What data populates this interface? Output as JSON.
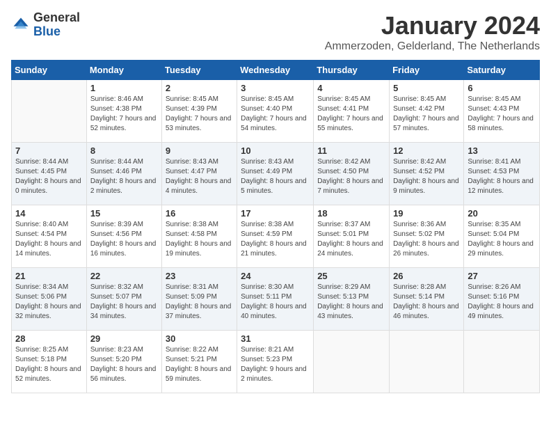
{
  "logo": {
    "general": "General",
    "blue": "Blue"
  },
  "title": "January 2024",
  "subtitle": "Ammerzoden, Gelderland, The Netherlands",
  "days_of_week": [
    "Sunday",
    "Monday",
    "Tuesday",
    "Wednesday",
    "Thursday",
    "Friday",
    "Saturday"
  ],
  "weeks": [
    [
      {
        "day": "",
        "sunrise": "",
        "sunset": "",
        "daylight": ""
      },
      {
        "day": "1",
        "sunrise": "Sunrise: 8:46 AM",
        "sunset": "Sunset: 4:38 PM",
        "daylight": "Daylight: 7 hours and 52 minutes."
      },
      {
        "day": "2",
        "sunrise": "Sunrise: 8:45 AM",
        "sunset": "Sunset: 4:39 PM",
        "daylight": "Daylight: 7 hours and 53 minutes."
      },
      {
        "day": "3",
        "sunrise": "Sunrise: 8:45 AM",
        "sunset": "Sunset: 4:40 PM",
        "daylight": "Daylight: 7 hours and 54 minutes."
      },
      {
        "day": "4",
        "sunrise": "Sunrise: 8:45 AM",
        "sunset": "Sunset: 4:41 PM",
        "daylight": "Daylight: 7 hours and 55 minutes."
      },
      {
        "day": "5",
        "sunrise": "Sunrise: 8:45 AM",
        "sunset": "Sunset: 4:42 PM",
        "daylight": "Daylight: 7 hours and 57 minutes."
      },
      {
        "day": "6",
        "sunrise": "Sunrise: 8:45 AM",
        "sunset": "Sunset: 4:43 PM",
        "daylight": "Daylight: 7 hours and 58 minutes."
      }
    ],
    [
      {
        "day": "7",
        "sunrise": "Sunrise: 8:44 AM",
        "sunset": "Sunset: 4:45 PM",
        "daylight": "Daylight: 8 hours and 0 minutes."
      },
      {
        "day": "8",
        "sunrise": "Sunrise: 8:44 AM",
        "sunset": "Sunset: 4:46 PM",
        "daylight": "Daylight: 8 hours and 2 minutes."
      },
      {
        "day": "9",
        "sunrise": "Sunrise: 8:43 AM",
        "sunset": "Sunset: 4:47 PM",
        "daylight": "Daylight: 8 hours and 4 minutes."
      },
      {
        "day": "10",
        "sunrise": "Sunrise: 8:43 AM",
        "sunset": "Sunset: 4:49 PM",
        "daylight": "Daylight: 8 hours and 5 minutes."
      },
      {
        "day": "11",
        "sunrise": "Sunrise: 8:42 AM",
        "sunset": "Sunset: 4:50 PM",
        "daylight": "Daylight: 8 hours and 7 minutes."
      },
      {
        "day": "12",
        "sunrise": "Sunrise: 8:42 AM",
        "sunset": "Sunset: 4:52 PM",
        "daylight": "Daylight: 8 hours and 9 minutes."
      },
      {
        "day": "13",
        "sunrise": "Sunrise: 8:41 AM",
        "sunset": "Sunset: 4:53 PM",
        "daylight": "Daylight: 8 hours and 12 minutes."
      }
    ],
    [
      {
        "day": "14",
        "sunrise": "Sunrise: 8:40 AM",
        "sunset": "Sunset: 4:54 PM",
        "daylight": "Daylight: 8 hours and 14 minutes."
      },
      {
        "day": "15",
        "sunrise": "Sunrise: 8:39 AM",
        "sunset": "Sunset: 4:56 PM",
        "daylight": "Daylight: 8 hours and 16 minutes."
      },
      {
        "day": "16",
        "sunrise": "Sunrise: 8:38 AM",
        "sunset": "Sunset: 4:58 PM",
        "daylight": "Daylight: 8 hours and 19 minutes."
      },
      {
        "day": "17",
        "sunrise": "Sunrise: 8:38 AM",
        "sunset": "Sunset: 4:59 PM",
        "daylight": "Daylight: 8 hours and 21 minutes."
      },
      {
        "day": "18",
        "sunrise": "Sunrise: 8:37 AM",
        "sunset": "Sunset: 5:01 PM",
        "daylight": "Daylight: 8 hours and 24 minutes."
      },
      {
        "day": "19",
        "sunrise": "Sunrise: 8:36 AM",
        "sunset": "Sunset: 5:02 PM",
        "daylight": "Daylight: 8 hours and 26 minutes."
      },
      {
        "day": "20",
        "sunrise": "Sunrise: 8:35 AM",
        "sunset": "Sunset: 5:04 PM",
        "daylight": "Daylight: 8 hours and 29 minutes."
      }
    ],
    [
      {
        "day": "21",
        "sunrise": "Sunrise: 8:34 AM",
        "sunset": "Sunset: 5:06 PM",
        "daylight": "Daylight: 8 hours and 32 minutes."
      },
      {
        "day": "22",
        "sunrise": "Sunrise: 8:32 AM",
        "sunset": "Sunset: 5:07 PM",
        "daylight": "Daylight: 8 hours and 34 minutes."
      },
      {
        "day": "23",
        "sunrise": "Sunrise: 8:31 AM",
        "sunset": "Sunset: 5:09 PM",
        "daylight": "Daylight: 8 hours and 37 minutes."
      },
      {
        "day": "24",
        "sunrise": "Sunrise: 8:30 AM",
        "sunset": "Sunset: 5:11 PM",
        "daylight": "Daylight: 8 hours and 40 minutes."
      },
      {
        "day": "25",
        "sunrise": "Sunrise: 8:29 AM",
        "sunset": "Sunset: 5:13 PM",
        "daylight": "Daylight: 8 hours and 43 minutes."
      },
      {
        "day": "26",
        "sunrise": "Sunrise: 8:28 AM",
        "sunset": "Sunset: 5:14 PM",
        "daylight": "Daylight: 8 hours and 46 minutes."
      },
      {
        "day": "27",
        "sunrise": "Sunrise: 8:26 AM",
        "sunset": "Sunset: 5:16 PM",
        "daylight": "Daylight: 8 hours and 49 minutes."
      }
    ],
    [
      {
        "day": "28",
        "sunrise": "Sunrise: 8:25 AM",
        "sunset": "Sunset: 5:18 PM",
        "daylight": "Daylight: 8 hours and 52 minutes."
      },
      {
        "day": "29",
        "sunrise": "Sunrise: 8:23 AM",
        "sunset": "Sunset: 5:20 PM",
        "daylight": "Daylight: 8 hours and 56 minutes."
      },
      {
        "day": "30",
        "sunrise": "Sunrise: 8:22 AM",
        "sunset": "Sunset: 5:21 PM",
        "daylight": "Daylight: 8 hours and 59 minutes."
      },
      {
        "day": "31",
        "sunrise": "Sunrise: 8:21 AM",
        "sunset": "Sunset: 5:23 PM",
        "daylight": "Daylight: 9 hours and 2 minutes."
      },
      {
        "day": "",
        "sunrise": "",
        "sunset": "",
        "daylight": ""
      },
      {
        "day": "",
        "sunrise": "",
        "sunset": "",
        "daylight": ""
      },
      {
        "day": "",
        "sunrise": "",
        "sunset": "",
        "daylight": ""
      }
    ]
  ]
}
